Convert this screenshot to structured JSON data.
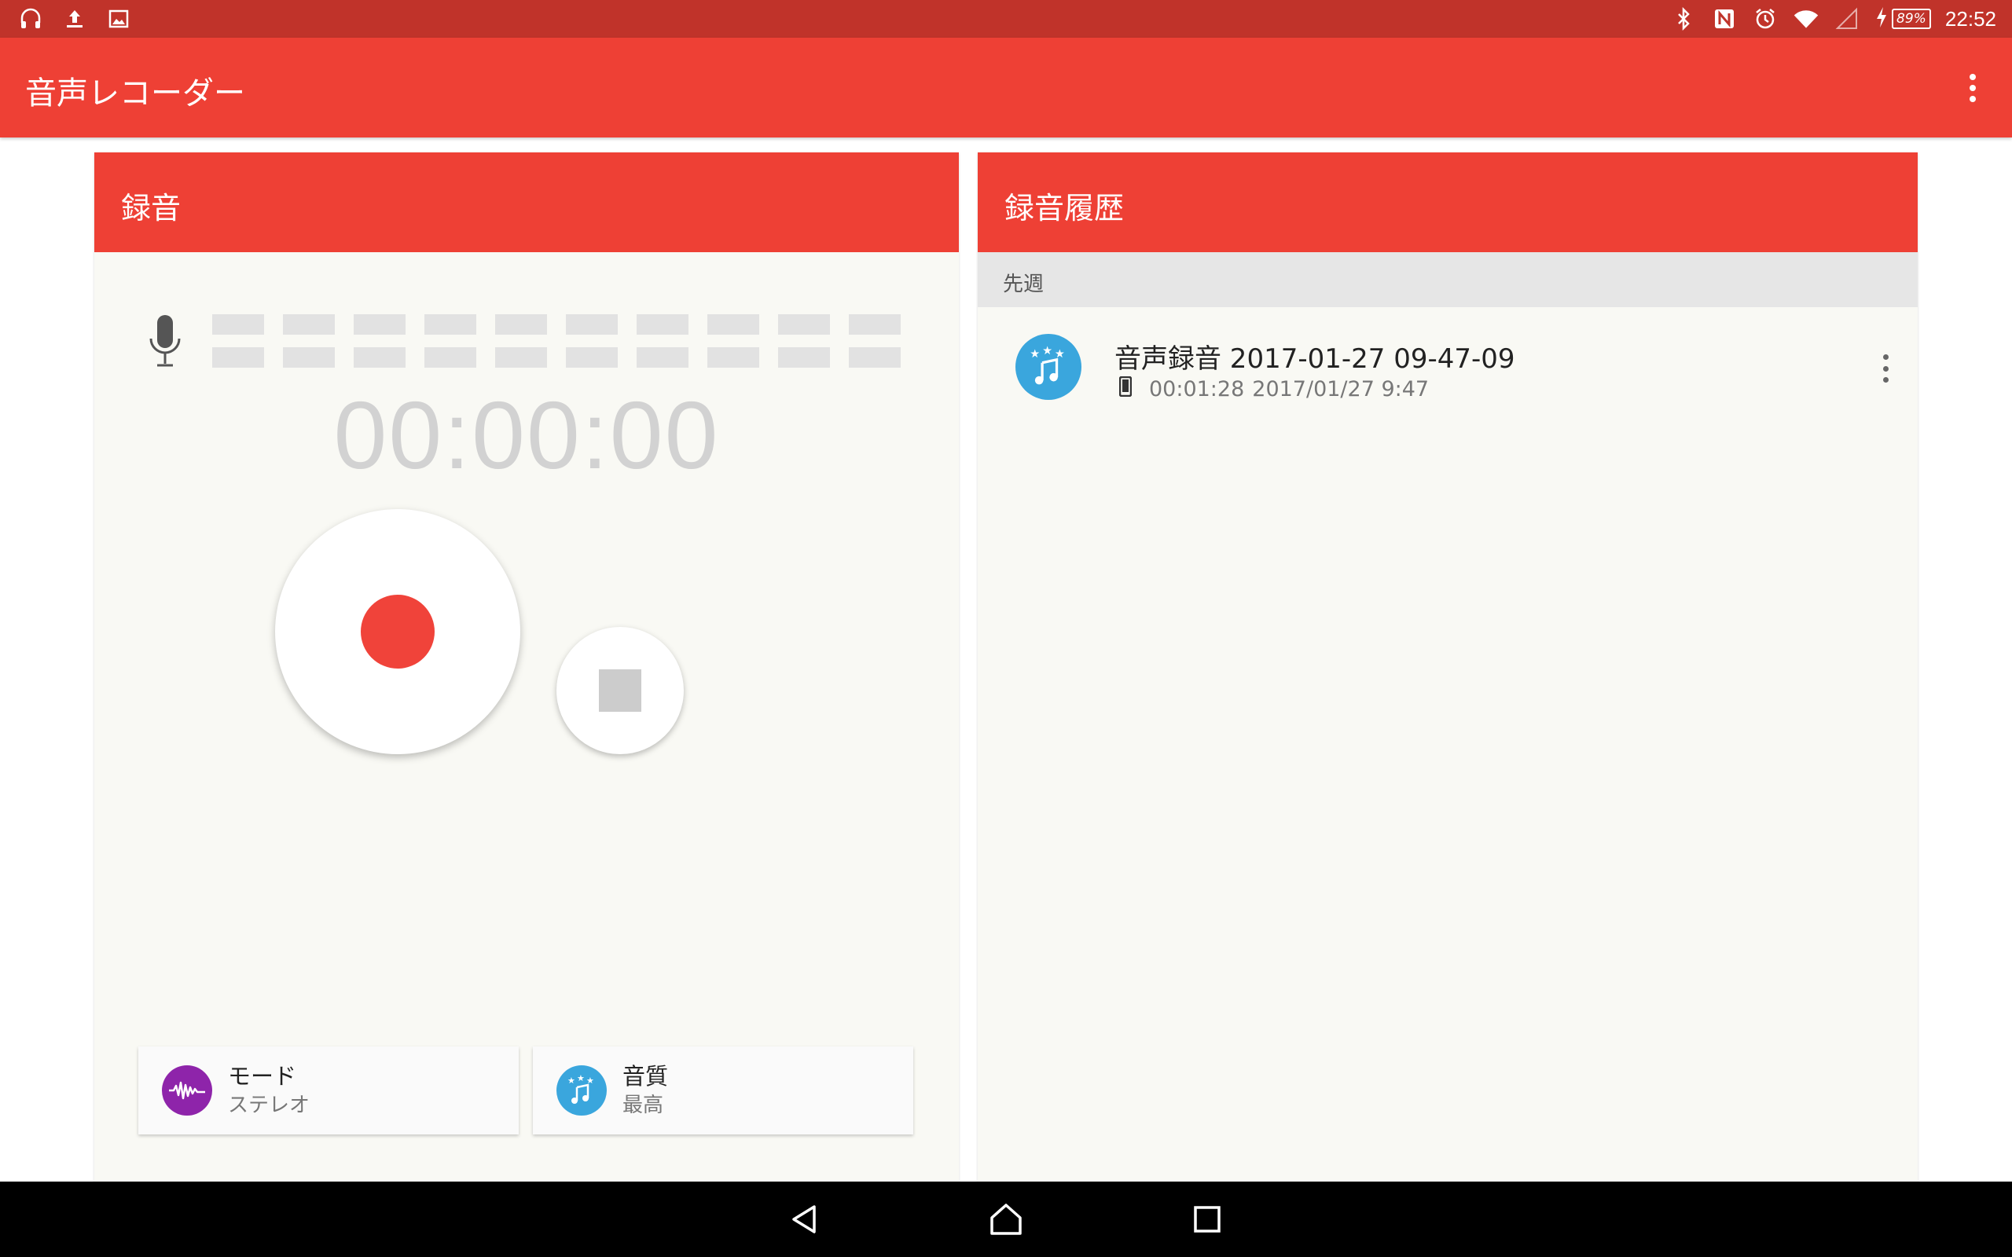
{
  "status_bar": {
    "time": "22:52",
    "battery_percent": "89%",
    "left_icons": [
      "headset-icon",
      "upload-icon",
      "image-icon"
    ],
    "right_icons": [
      "bluetooth-icon",
      "nfc-icon",
      "alarm-icon",
      "wifi-icon",
      "cell-signal-icon",
      "charging-icon"
    ]
  },
  "app_bar": {
    "title": "音声レコーダー",
    "overflow_icon": "more-vert-icon"
  },
  "recording_panel": {
    "header": "録音",
    "timer": "00:00:00",
    "record_button_icon": "record-icon",
    "stop_button_icon": "stop-icon",
    "mode": {
      "title": "モード",
      "value": "ステレオ",
      "icon": "waveform-icon"
    },
    "quality": {
      "title": "音質",
      "value": "最高",
      "icon": "music-note-stars-icon"
    }
  },
  "history_panel": {
    "header": "録音履歴",
    "section_label": "先週",
    "items": [
      {
        "title": "音声録音 2017-01-27 09-47-09",
        "duration": "00:01:28",
        "date": "2017/01/27 9:47",
        "storage_icon": "phone-icon"
      }
    ]
  },
  "colors": {
    "status_bar": "#c0332a",
    "accent": "#ee4035",
    "record_dot": "#f0433a",
    "mode_icon_bg": "#8e24aa",
    "quality_icon_bg": "#3aa6dd",
    "panel_bg": "#f9f9f4"
  },
  "nav_bar": {
    "buttons": [
      "back-icon",
      "home-icon",
      "recents-icon"
    ]
  }
}
